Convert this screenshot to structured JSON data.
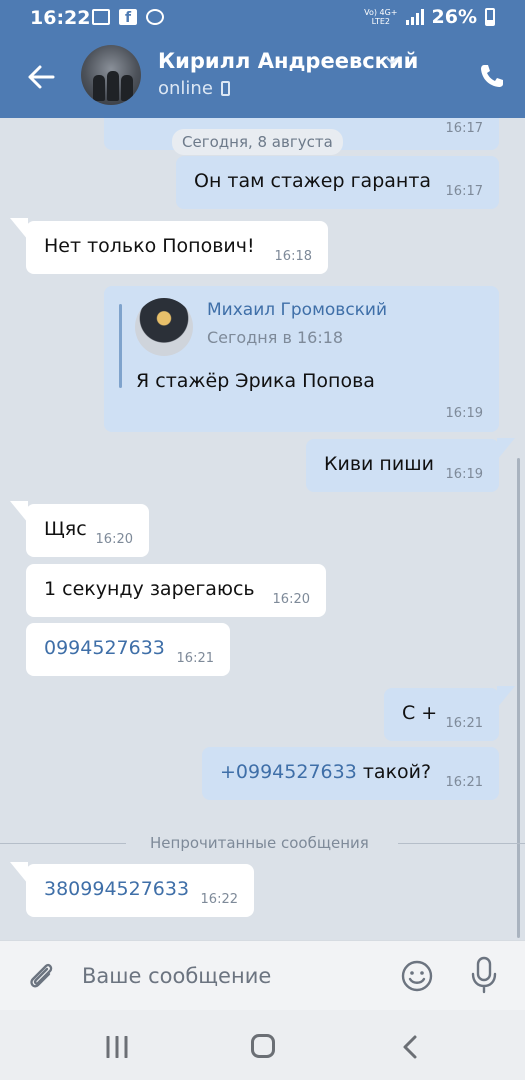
{
  "status_bar": {
    "time": "16:22",
    "network_top": "Vo) 4G+",
    "network_bottom": "LTE2",
    "battery": "26%"
  },
  "header": {
    "contact_name": "Кирилл Андреевский",
    "status": "online",
    "back_icon": "arrow-left-icon",
    "call_icon": "phone-icon",
    "accent_color": "#4e7bb3"
  },
  "date_separator": "Сегодня, 8 августа",
  "messages": [
    {
      "dir": "out",
      "text": "Он там стажер гаранта",
      "time": "16:17"
    },
    {
      "dir": "in",
      "text": "Нет только Попович!",
      "time": "16:18"
    },
    {
      "dir": "out",
      "forwarded": {
        "author": "Михаил Громовский",
        "date": "Сегодня в 16:18",
        "text": "Я стажёр Эрика Попова"
      },
      "time": "16:19"
    },
    {
      "dir": "out",
      "text": "Киви пиши",
      "time": "16:19"
    },
    {
      "dir": "in",
      "text": "Щяс",
      "time": "16:20"
    },
    {
      "dir": "in",
      "text": "1 секунду зарегаюсь",
      "time": "16:20"
    },
    {
      "dir": "in",
      "link": "0994527633",
      "time": "16:21"
    },
    {
      "dir": "out",
      "text": "С +",
      "time": "16:21"
    },
    {
      "dir": "out",
      "link": "+0994527633",
      "text": " такой?",
      "time": "16:21"
    },
    {
      "dir": "in",
      "link": "380994527633",
      "time": "16:22"
    }
  ],
  "previous_message_time": "16:17",
  "unread_divider": "Непрочитанные сообщения",
  "composer": {
    "placeholder": "Ваше сообщение",
    "attach_icon": "paperclip-icon",
    "emoji_icon": "smile-icon",
    "voice_icon": "microphone-icon"
  },
  "colors": {
    "chat_background": "#dbe1e8",
    "incoming_bubble": "#ffffff",
    "outgoing_bubble": "#cfe0f4",
    "link": "#3f6fa8"
  }
}
